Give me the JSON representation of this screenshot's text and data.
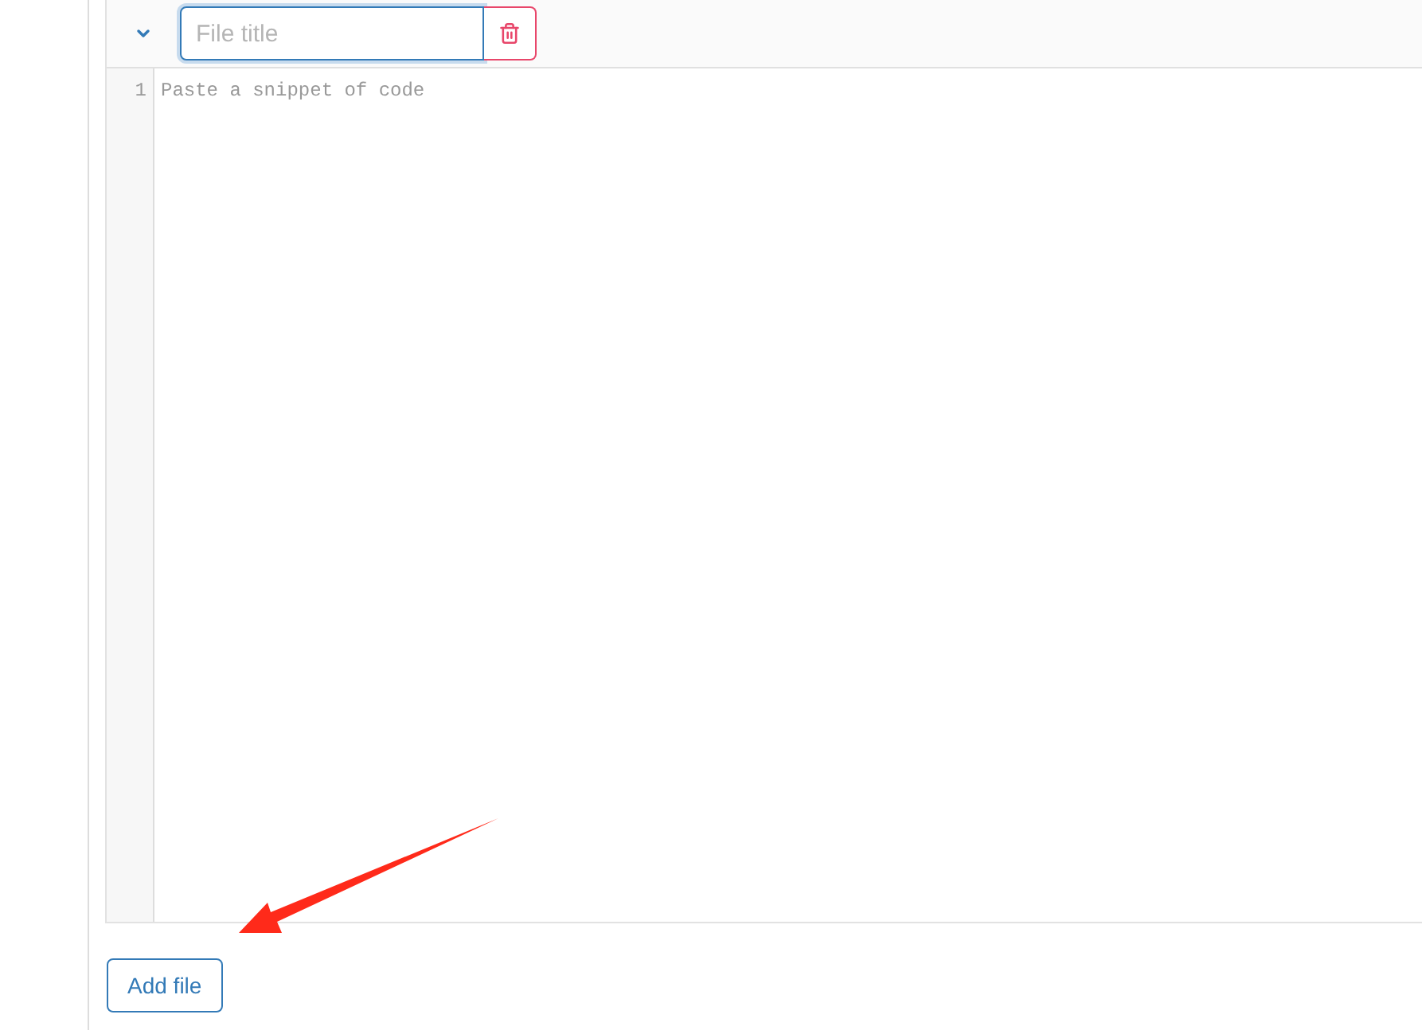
{
  "file_panel": {
    "expanded": true,
    "title_field": {
      "placeholder": "File title",
      "focused": true
    }
  },
  "editor": {
    "line_numbers": [
      "1"
    ],
    "placeholder": "Paste a snippet of code"
  },
  "add_file_button": {
    "label": "Add file"
  },
  "annotations": [
    {
      "kind": "arrow"
    }
  ]
}
